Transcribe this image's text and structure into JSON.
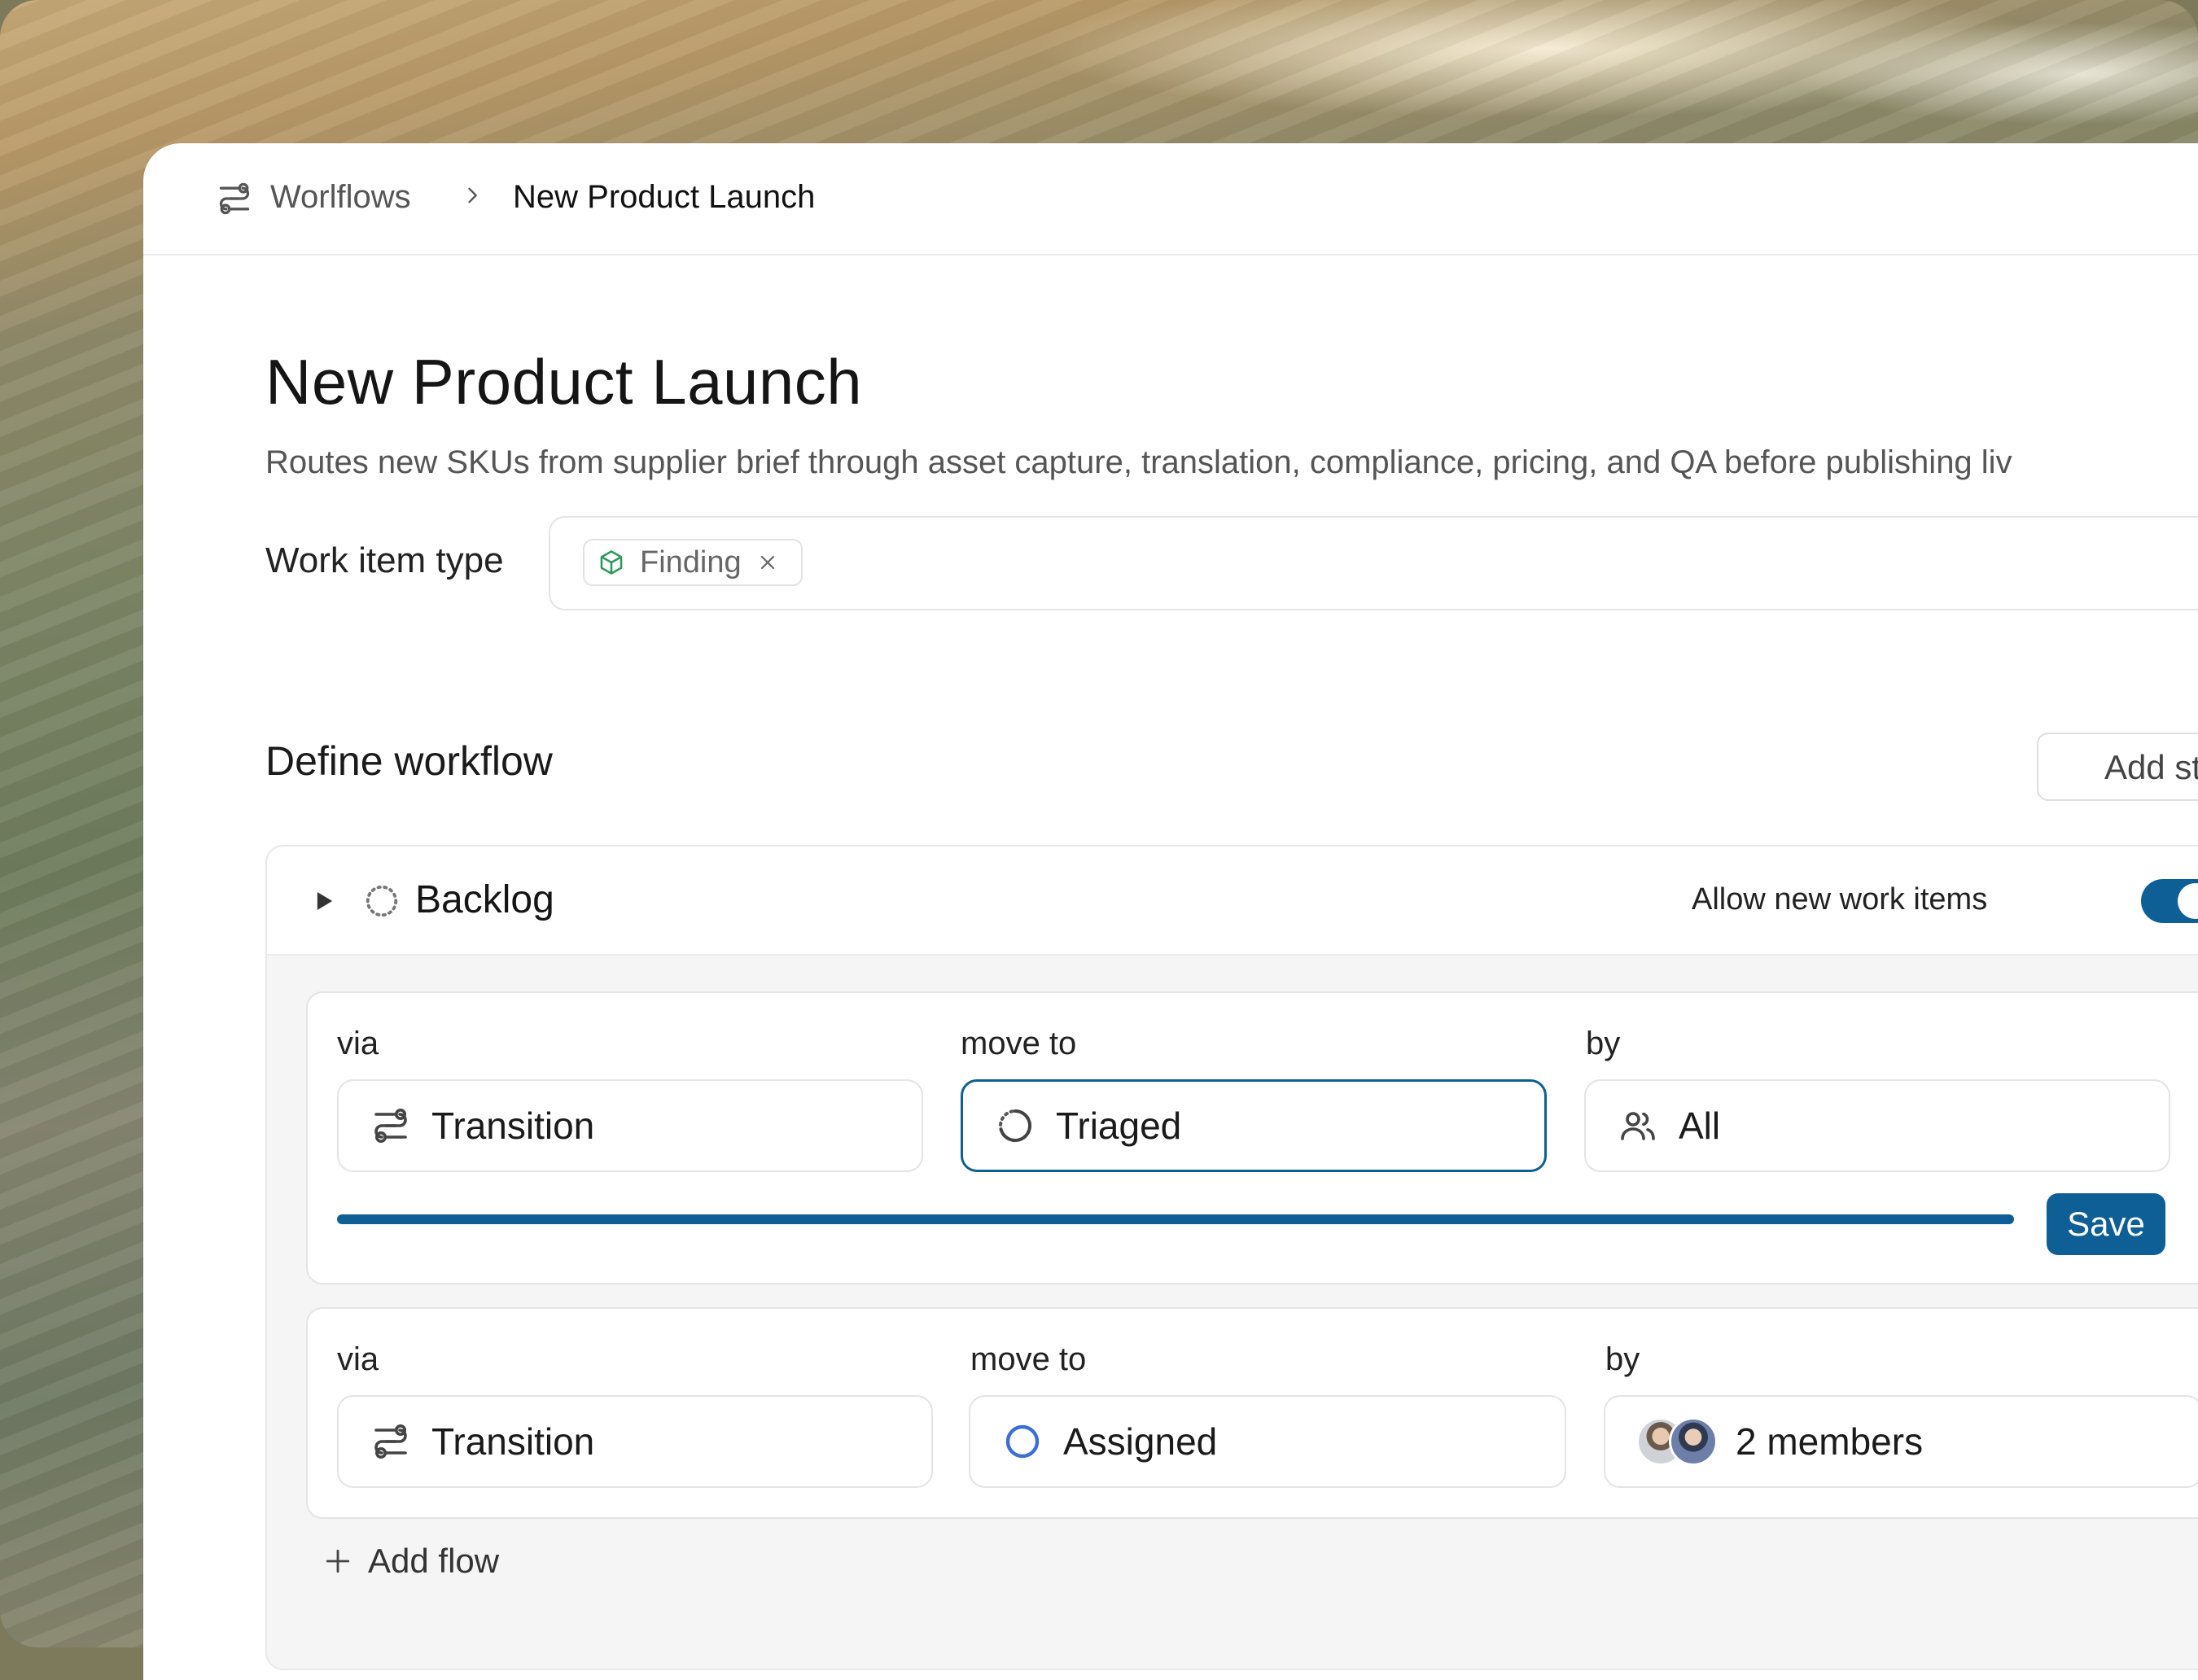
{
  "breadcrumb": {
    "root": "Worlflows",
    "current": "New Product Launch"
  },
  "page": {
    "title": "New Product Launch",
    "description": "Routes new SKUs from supplier brief through asset capture, translation, compliance, pricing, and QA before publishing liv"
  },
  "work_item_type": {
    "label": "Work item type",
    "chip": "Finding"
  },
  "workflow": {
    "title": "Define workflow",
    "add_state_label": "Add stat",
    "state": {
      "name": "Backlog",
      "allow_label": "Allow new work items",
      "allow_enabled": true
    },
    "flows": [
      {
        "via_label": "via",
        "move_label": "move to",
        "by_label": "by",
        "via_value": "Transition",
        "move_value": "Triaged",
        "by_value": "All",
        "save_label": "Save",
        "progress": 1.0
      },
      {
        "via_label": "via",
        "move_label": "move to",
        "by_label": "by",
        "via_value": "Transition",
        "move_value": "Assigned",
        "by_value": "2 members"
      }
    ],
    "add_flow_label": "Add flow"
  },
  "colors": {
    "accent": "#0e5f95",
    "assigned_ring": "#3b6fd6",
    "finding_icon": "#2e9a5a"
  }
}
